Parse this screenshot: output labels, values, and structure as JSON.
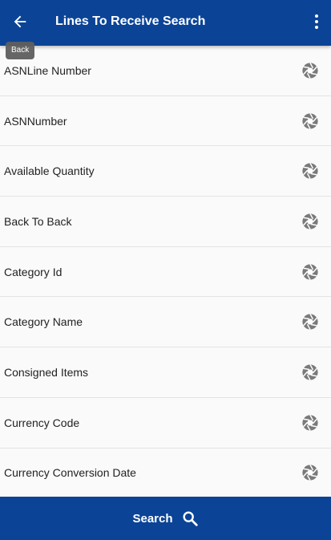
{
  "header": {
    "title": "Lines To Receive Search",
    "back_icon": "arrow-left-icon",
    "menu_icon": "more-vertical-icon",
    "tooltip": "Back",
    "background": "#0b4496"
  },
  "fields": [
    {
      "label": "ASNLine Number",
      "icon": "aperture-icon"
    },
    {
      "label": "ASNNumber",
      "icon": "aperture-icon"
    },
    {
      "label": "Available Quantity",
      "icon": "aperture-icon"
    },
    {
      "label": "Back To Back",
      "icon": "aperture-icon"
    },
    {
      "label": "Category Id",
      "icon": "aperture-icon"
    },
    {
      "label": "Category Name",
      "icon": "aperture-icon"
    },
    {
      "label": "Consigned Items",
      "icon": "aperture-icon"
    },
    {
      "label": "Currency Code",
      "icon": "aperture-icon"
    },
    {
      "label": "Currency Conversion Date",
      "icon": "aperture-icon"
    }
  ],
  "footer": {
    "search_label": "Search",
    "search_icon": "search-icon",
    "background": "#0b4496"
  }
}
